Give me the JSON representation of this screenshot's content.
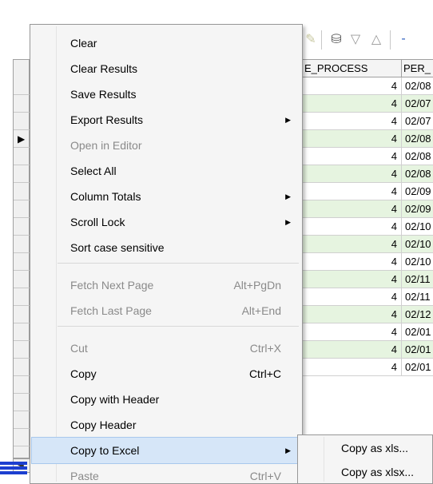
{
  "grid": {
    "headers": [
      "E_PROCESS",
      "PER_"
    ],
    "rows": [
      {
        "n": "4",
        "d": "02/08"
      },
      {
        "n": "4",
        "d": "02/07"
      },
      {
        "n": "4",
        "d": "02/07"
      },
      {
        "n": "4",
        "d": "02/08"
      },
      {
        "n": "4",
        "d": "02/08"
      },
      {
        "n": "4",
        "d": "02/08"
      },
      {
        "n": "4",
        "d": "02/09"
      },
      {
        "n": "4",
        "d": "02/09"
      },
      {
        "n": "4",
        "d": "02/10"
      },
      {
        "n": "4",
        "d": "02/10"
      },
      {
        "n": "4",
        "d": "02/10"
      },
      {
        "n": "4",
        "d": "02/11"
      },
      {
        "n": "4",
        "d": "02/11"
      },
      {
        "n": "4",
        "d": "02/12"
      },
      {
        "n": "4",
        "d": "02/01"
      },
      {
        "n": "4",
        "d": "02/01"
      },
      {
        "n": "4",
        "d": "02/01"
      }
    ]
  },
  "menu": {
    "items": [
      {
        "label": "Clear",
        "enabled": true
      },
      {
        "label": "Clear Results",
        "enabled": true
      },
      {
        "label": "Save Results",
        "enabled": true
      },
      {
        "label": "Export Results",
        "enabled": true,
        "submenu": true
      },
      {
        "label": "Open in Editor",
        "enabled": false
      },
      {
        "label": "Select All",
        "enabled": true
      },
      {
        "label": "Column Totals",
        "enabled": true,
        "submenu": true
      },
      {
        "label": "Scroll Lock",
        "enabled": true,
        "submenu": true
      },
      {
        "label": "Sort case sensitive",
        "enabled": true
      },
      {
        "label": "Fetch Next Page",
        "enabled": false,
        "shortcut": "Alt+PgDn"
      },
      {
        "label": "Fetch Last Page",
        "enabled": false,
        "shortcut": "Alt+End"
      },
      {
        "label": "Cut",
        "enabled": false,
        "shortcut": "Ctrl+X"
      },
      {
        "label": "Copy",
        "enabled": true,
        "shortcut": "Ctrl+C"
      },
      {
        "label": "Copy with Header",
        "enabled": true
      },
      {
        "label": "Copy Header",
        "enabled": true
      },
      {
        "label": "Copy to Excel",
        "enabled": true,
        "submenu": true,
        "highlighted": true
      },
      {
        "label": "Paste",
        "enabled": false,
        "shortcut": "Ctrl+V"
      }
    ]
  },
  "submenu": {
    "items": [
      {
        "label": "Copy as xls..."
      },
      {
        "label": "Copy as xlsx..."
      }
    ]
  },
  "colors": {
    "alt_row": "#e6f4e0",
    "highlight": "#d6e6f8",
    "disabled_text": "#8a8a8a"
  }
}
